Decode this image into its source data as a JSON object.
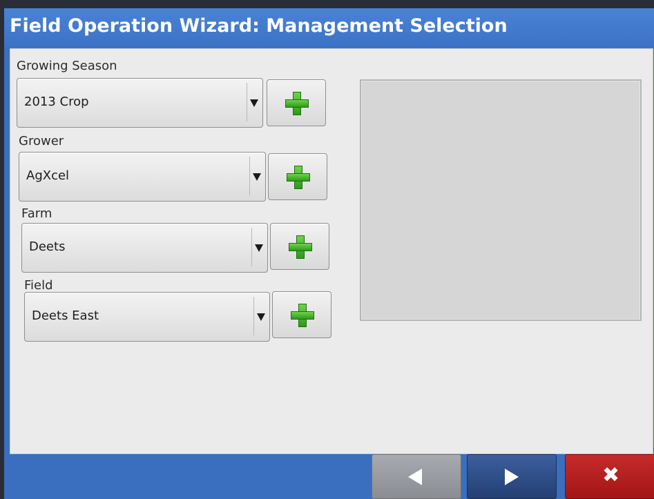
{
  "window": {
    "title": "Field Operation Wizard: Management Selection"
  },
  "fields": [
    {
      "label": "Growing Season",
      "value": "2013 Crop"
    },
    {
      "label": "Grower",
      "value": "AgXcel"
    },
    {
      "label": "Farm",
      "value": "Deets"
    },
    {
      "label": "Field",
      "value": "Deets East"
    }
  ],
  "icons": {
    "add": "plus-icon",
    "dropdown": "triangle-down-icon",
    "back": "arrow-left-icon",
    "next": "arrow-right-icon",
    "cancel": "x-icon"
  },
  "footer": {
    "cancel_glyph": "✖"
  },
  "colors": {
    "title_bar": "#4a82d6",
    "content_bg": "#ebebeb",
    "add_green": "#3cb528",
    "next_blue": "#243f73",
    "cancel_red": "#b31f1f"
  }
}
